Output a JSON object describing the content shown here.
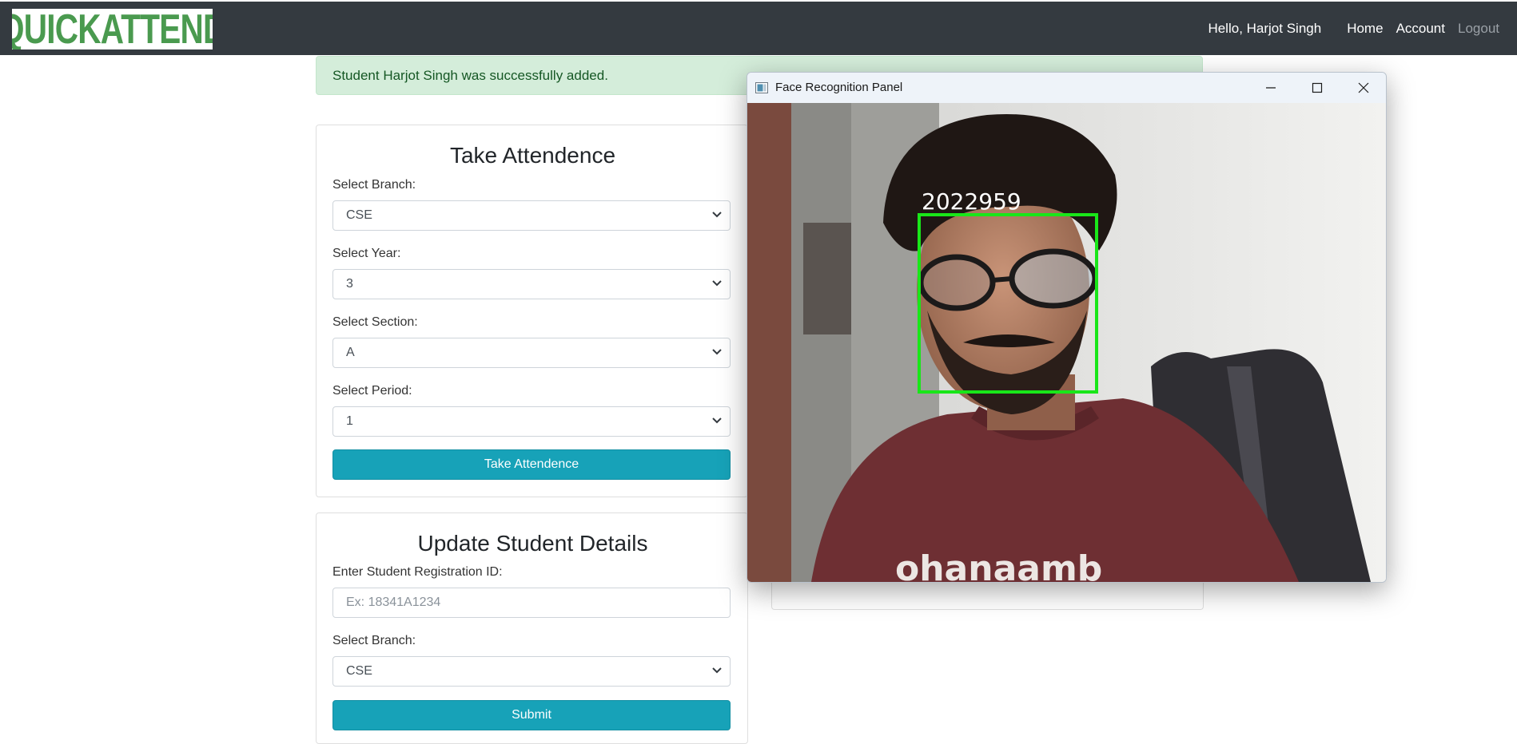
{
  "navbar": {
    "logo_text": "QUICKATTEND",
    "greeting": "Hello, Harjot Singh",
    "links": [
      "Home",
      "Account",
      "Logout"
    ]
  },
  "alert": {
    "message": "Student Harjot Singh was successfully added."
  },
  "take_attendance": {
    "title": "Take Attendence",
    "branch_label": "Select Branch:",
    "branch_value": "CSE",
    "year_label": "Select Year:",
    "year_value": "3",
    "section_label": "Select Section:",
    "section_value": "A",
    "period_label": "Select Period:",
    "period_value": "1",
    "button": "Take Attendence"
  },
  "update_student": {
    "title": "Update Student Details",
    "reg_label": "Enter Student Registration ID:",
    "reg_placeholder": "Ex: 18341A1234",
    "branch_label": "Select Branch:",
    "branch_value": "CSE",
    "button": "Submit"
  },
  "face_window": {
    "title": "Face Recognition Panel",
    "recognized_id": "2022959",
    "detection_box_color": "#19e619"
  },
  "colors": {
    "navbar_bg": "#343a40",
    "accent": "#17a2b8",
    "alert_bg": "#d4edda",
    "alert_text": "#155724",
    "logo_green": "#4a9a4f"
  }
}
